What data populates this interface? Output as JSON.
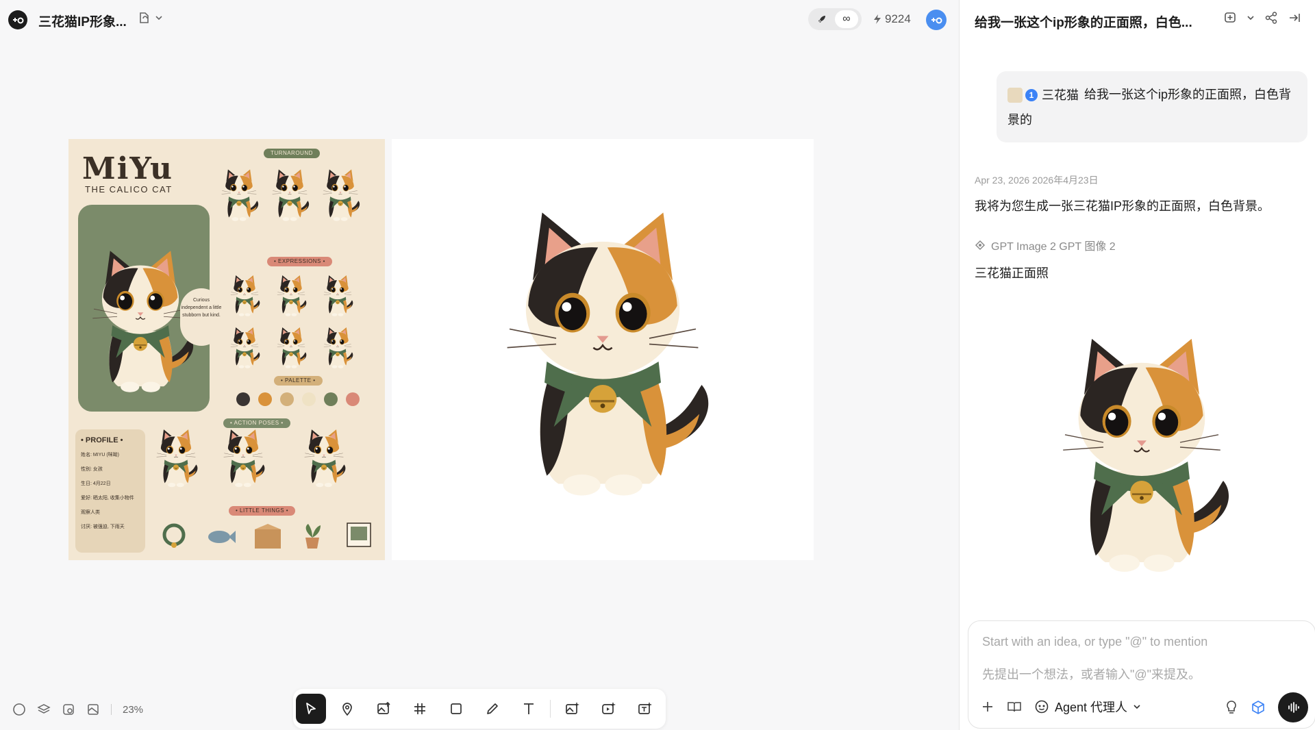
{
  "header": {
    "project_title": "三花猫IP形象...",
    "credits": "9224",
    "infinity_symbol": "∞"
  },
  "canvas": {
    "zoom": "23%",
    "sheet": {
      "title": "MiYu",
      "subtitle": "THE CALICO CAT",
      "quote": "Curious independent a little stubborn but kind.",
      "tags": {
        "turnaround": "TURNAROUND",
        "expressions": "• EXPRESSIONS •",
        "palette": "• PALETTE •",
        "action_poses": "• ACTION POSES •",
        "little_things": "• LITTLE THINGS •"
      },
      "profile": {
        "title": "• PROFILE •",
        "lines": [
          "姓名: MIYU (咪呦)",
          "性别: 女孩",
          "生日: 4月22日",
          "爱好: 晒太阳, 收集小物件",
          "观察人类",
          "讨厌: 被强迫, 下雨天"
        ]
      },
      "palette_colors": [
        "#3a3533",
        "#d9923a",
        "#d3b07a",
        "#efe2c4",
        "#6f7f5a",
        "#d98977"
      ]
    }
  },
  "toolbar": {
    "tools": [
      "select-tool",
      "location-tool",
      "image-upload-tool",
      "frame-tool",
      "shape-tool",
      "pen-tool",
      "text-tool",
      "image-generate-tool",
      "video-generate-tool",
      "text-generate-tool"
    ]
  },
  "chat": {
    "title": "给我一张这个ip形象的正面照，白色...",
    "user_message": {
      "ref_number": "1",
      "ref_name": "三花猫",
      "text": "给我一张这个ip形象的正面照，白色背景的"
    },
    "timestamp": "Apr 23, 2026  2026年4月23日",
    "assistant_text": "我将为您生成一张三花猫IP形象的正面照，白色背景。",
    "model": "GPT Image 2  GPT 图像 2",
    "result_title": "三花猫正面照"
  },
  "composer": {
    "placeholder_en": "Start with an idea, or type \"@\" to mention",
    "placeholder_zh": "先提出一个想法，或者输入\"@\"来提及。",
    "agent_label": "Agent  代理人"
  },
  "colors": {
    "accent_blue": "#3b82f6",
    "dark": "#1c1c1c",
    "panel_bg": "#ffffff",
    "canvas_bg": "#f7f7f8"
  }
}
